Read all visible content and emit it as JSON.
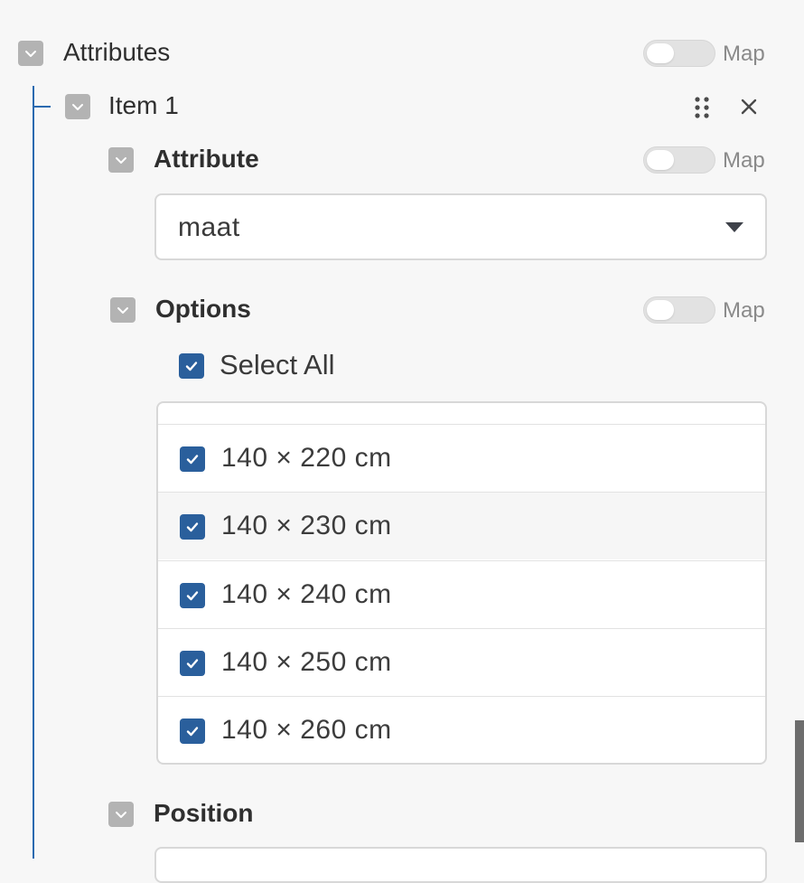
{
  "attributes": {
    "title": "Attributes",
    "map_label": "Map",
    "item": {
      "title": "Item 1",
      "attribute": {
        "label": "Attribute",
        "map_label": "Map",
        "selected_value": "maat"
      },
      "options": {
        "label": "Options",
        "map_label": "Map",
        "select_all_label": "Select All",
        "select_all_checked": true,
        "items": [
          {
            "label": "140 × 220 cm",
            "checked": true
          },
          {
            "label": "140 × 230 cm",
            "checked": true
          },
          {
            "label": "140 × 240 cm",
            "checked": true
          },
          {
            "label": "140 × 250 cm",
            "checked": true
          },
          {
            "label": "140 × 260 cm",
            "checked": true
          }
        ]
      },
      "position": {
        "label": "Position"
      }
    }
  },
  "colors": {
    "accent": "#2a5f9c",
    "tree_line": "#2a6ab0",
    "background": "#f7f7f7"
  },
  "icons": [
    "chevron-down-icon",
    "drag-handle-icon",
    "close-icon",
    "check-icon",
    "caret-down-icon"
  ]
}
